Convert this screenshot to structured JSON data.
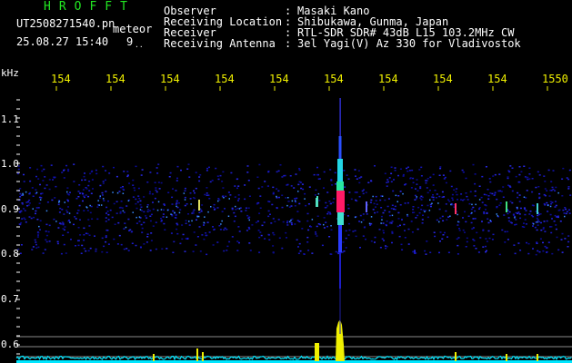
{
  "header": {
    "app_title": "HROFFT",
    "filename": "UT2508271540.pn",
    "mode": "meteor",
    "datetime": "25.08.27 15:40",
    "count": "9",
    "count_suffix": "..",
    "fields": [
      {
        "label": "Observer",
        "sep": ":",
        "value": "Masaki Kano"
      },
      {
        "label": "Receiving Location",
        "sep": ":",
        "value": "Shibukawa, Gunma, Japan"
      },
      {
        "label": "Receiver",
        "sep": ":",
        "value": "RTL-SDR SDR# 43dB L15 103.2MHz CW"
      },
      {
        "label": "Receiving Antenna",
        "sep": ":",
        "value": "3el Yagi(V) Az 330 for Vladivostok"
      }
    ]
  },
  "time_axis": {
    "labels": [
      "154",
      "154",
      "154",
      "154",
      "154",
      "154",
      "154",
      "154",
      "154",
      "1550"
    ]
  },
  "freq_axis": {
    "unit": "kHz",
    "labels": [
      "1.1",
      "1.0",
      "0.9",
      "0.8",
      "0.7",
      "0.6"
    ]
  },
  "colors": {
    "background": "#000000",
    "text": "#ffffff",
    "title": "#22e622",
    "time_labels": "#f0f000",
    "noise_band": "#1010c8",
    "signal_hot": "#ff1a66",
    "signal_mid": "#22d6e6",
    "power_trace": "#00e6ff",
    "power_peak": "#f0f000"
  }
}
